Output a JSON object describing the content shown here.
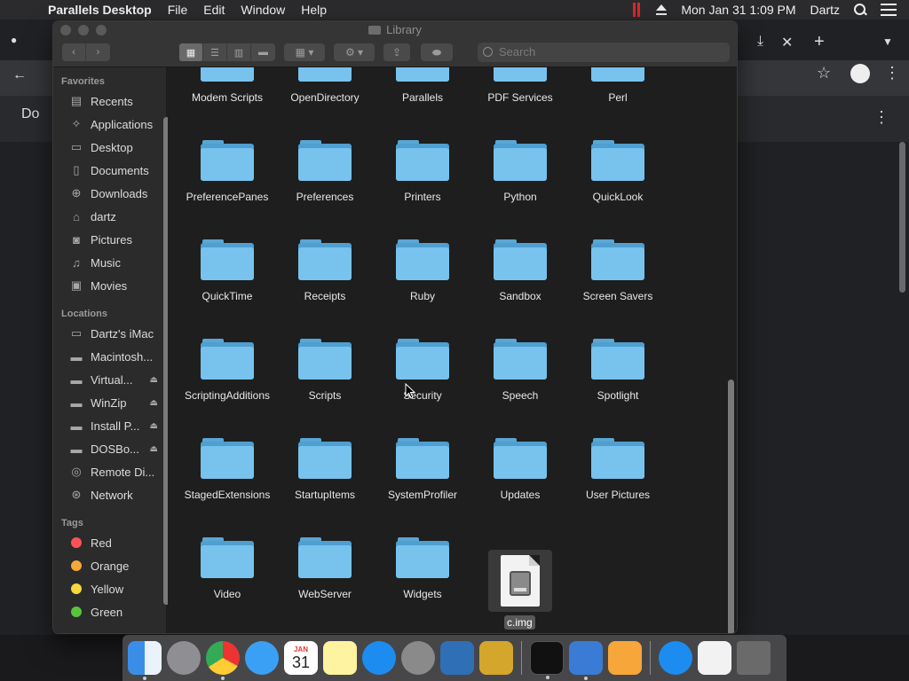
{
  "menubar": {
    "apple": "",
    "app_name": "Parallels Desktop",
    "menus": [
      "File",
      "Edit",
      "Window",
      "Help"
    ],
    "clock": "Mon Jan 31  1:09 PM",
    "user": "Dartz"
  },
  "background_window": {
    "doc_label": "Do"
  },
  "finder": {
    "title": "Library",
    "search_placeholder": "Search",
    "sidebar": {
      "favorites_label": "Favorites",
      "favorites": [
        {
          "label": "Recents",
          "icon": "recents-icon"
        },
        {
          "label": "Applications",
          "icon": "applications-icon"
        },
        {
          "label": "Desktop",
          "icon": "desktop-icon"
        },
        {
          "label": "Documents",
          "icon": "documents-icon"
        },
        {
          "label": "Downloads",
          "icon": "downloads-icon"
        },
        {
          "label": "dartz",
          "icon": "home-icon"
        },
        {
          "label": "Pictures",
          "icon": "pictures-icon"
        },
        {
          "label": "Music",
          "icon": "music-icon"
        },
        {
          "label": "Movies",
          "icon": "movies-icon"
        }
      ],
      "locations_label": "Locations",
      "locations": [
        {
          "label": "Dartz's iMac",
          "icon": "imac-icon"
        },
        {
          "label": "Macintosh...",
          "icon": "disk-icon"
        },
        {
          "label": "Virtual...",
          "icon": "disk-icon"
        },
        {
          "label": "WinZip",
          "icon": "disk-icon"
        },
        {
          "label": "Install P...",
          "icon": "disk-icon"
        },
        {
          "label": "DOSBo...",
          "icon": "disk-icon"
        },
        {
          "label": "Remote Di...",
          "icon": "remote-disc-icon"
        },
        {
          "label": "Network",
          "icon": "network-icon"
        }
      ],
      "tags_label": "Tags",
      "tags": [
        {
          "label": "Red",
          "color": "#ff5257"
        },
        {
          "label": "Orange",
          "color": "#f5a83b"
        },
        {
          "label": "Yellow",
          "color": "#f6d83d"
        },
        {
          "label": "Green",
          "color": "#58c53d"
        }
      ]
    },
    "items": [
      "Modem Scripts",
      "OpenDirectory",
      "Parallels",
      "PDF Services",
      "Perl",
      "PreferencePanes",
      "Preferences",
      "Printers",
      "Python",
      "QuickLook",
      "QuickTime",
      "Receipts",
      "Ruby",
      "Sandbox",
      "Screen Savers",
      "ScriptingAdditions",
      "Scripts",
      "Security",
      "Speech",
      "Spotlight",
      "StagedExtensions",
      "StartupItems",
      "SystemProfiler",
      "Updates",
      "User Pictures",
      "Video",
      "WebServer",
      "Widgets"
    ],
    "selected_file": "c.img",
    "folder_color": "#77c3ee"
  },
  "dock": {
    "apps": [
      "finder-icon",
      "launchpad-icon",
      "chrome-icon",
      "safari-icon",
      "calendar-icon",
      "notes-icon",
      "app-store-icon",
      "system-preferences-icon",
      "virtualbox-icon",
      "archive-utility-icon",
      "terminal-icon",
      "parallels-icon",
      "home-app-icon",
      "app-store-download-icon",
      "disk-image-icon",
      "trash-icon"
    ],
    "calendar_month": "JAN",
    "calendar_day": "31"
  }
}
